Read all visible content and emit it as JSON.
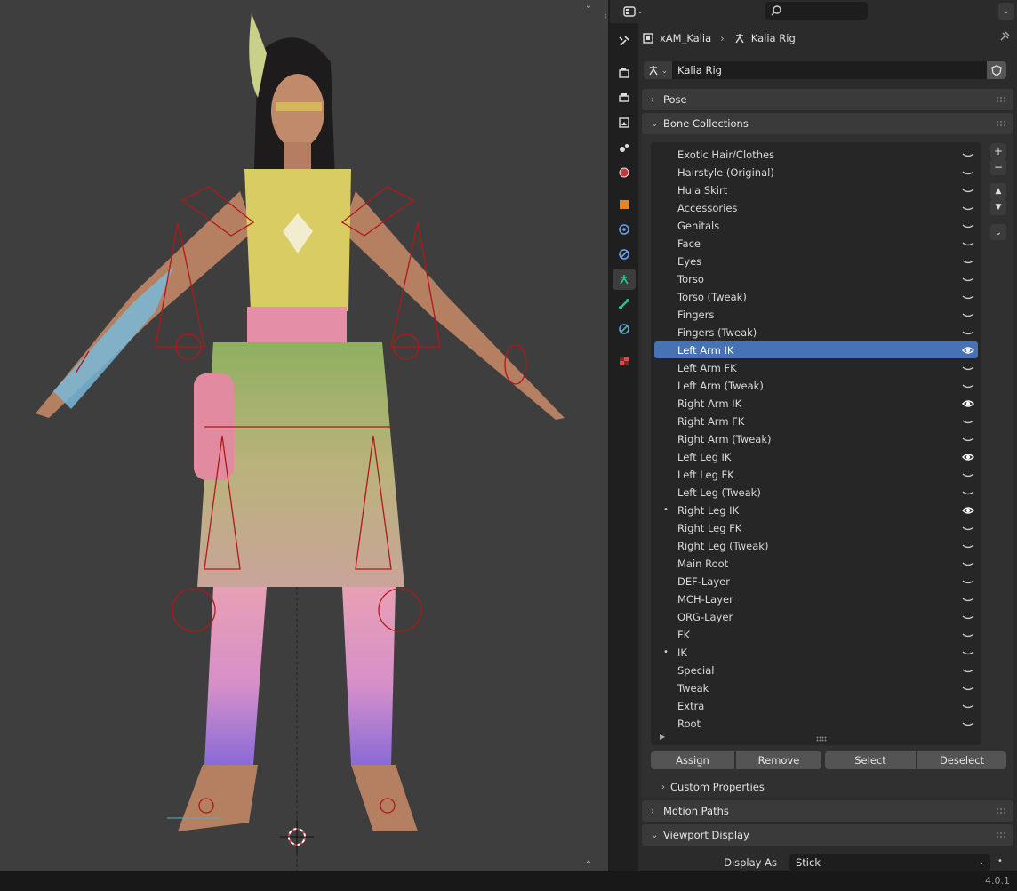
{
  "header": {
    "search_placeholder": ""
  },
  "breadcrumb": {
    "object_name": "xAM_Kalia",
    "armature_name": "Kalia Rig"
  },
  "datablock": {
    "name": "Kalia Rig"
  },
  "panels": {
    "pose": "Pose",
    "bone_collections": "Bone Collections",
    "custom_properties": "Custom Properties",
    "motion_paths": "Motion Paths",
    "viewport_display": "Viewport Display"
  },
  "bone_collections": [
    {
      "name": "Exotic Hair/Clothes",
      "visible": false,
      "dot": false
    },
    {
      "name": "Hairstyle (Original)",
      "visible": false,
      "dot": false
    },
    {
      "name": "Hula Skirt",
      "visible": false,
      "dot": false
    },
    {
      "name": "Accessories",
      "visible": false,
      "dot": false
    },
    {
      "name": "Genitals",
      "visible": false,
      "dot": false
    },
    {
      "name": "Face",
      "visible": false,
      "dot": false
    },
    {
      "name": "Eyes",
      "visible": false,
      "dot": false
    },
    {
      "name": "Torso",
      "visible": false,
      "dot": false
    },
    {
      "name": "Torso (Tweak)",
      "visible": false,
      "dot": false
    },
    {
      "name": "Fingers",
      "visible": false,
      "dot": false
    },
    {
      "name": "Fingers (Tweak)",
      "visible": false,
      "dot": false
    },
    {
      "name": "Left Arm IK",
      "visible": true,
      "dot": false,
      "selected": true
    },
    {
      "name": "Left Arm FK",
      "visible": false,
      "dot": false
    },
    {
      "name": "Left Arm (Tweak)",
      "visible": false,
      "dot": false
    },
    {
      "name": "Right Arm IK",
      "visible": true,
      "dot": false
    },
    {
      "name": "Right Arm FK",
      "visible": false,
      "dot": false
    },
    {
      "name": "Right Arm (Tweak)",
      "visible": false,
      "dot": false
    },
    {
      "name": "Left Leg IK",
      "visible": true,
      "dot": false
    },
    {
      "name": "Left Leg FK",
      "visible": false,
      "dot": false
    },
    {
      "name": "Left Leg (Tweak)",
      "visible": false,
      "dot": false
    },
    {
      "name": "Right Leg IK",
      "visible": true,
      "dot": true
    },
    {
      "name": "Right Leg FK",
      "visible": false,
      "dot": false
    },
    {
      "name": "Right Leg (Tweak)",
      "visible": false,
      "dot": false
    },
    {
      "name": "Main Root",
      "visible": false,
      "dot": false
    },
    {
      "name": "DEF-Layer",
      "visible": false,
      "dot": false
    },
    {
      "name": "MCH-Layer",
      "visible": false,
      "dot": false
    },
    {
      "name": "ORG-Layer",
      "visible": false,
      "dot": false
    },
    {
      "name": "FK",
      "visible": false,
      "dot": false
    },
    {
      "name": "IK",
      "visible": false,
      "dot": true
    },
    {
      "name": "Special",
      "visible": false,
      "dot": false
    },
    {
      "name": "Tweak",
      "visible": false,
      "dot": false
    },
    {
      "name": "Extra",
      "visible": false,
      "dot": false
    },
    {
      "name": "Root",
      "visible": false,
      "dot": false
    }
  ],
  "buttons": {
    "assign": "Assign",
    "remove": "Remove",
    "select": "Select",
    "deselect": "Deselect"
  },
  "viewport_display": {
    "display_as_label": "Display As",
    "display_as_value": "Stick"
  },
  "status": {
    "version": "4.0.1"
  },
  "colors": {
    "selection": "#4772b3",
    "panel_header": "#3a3a3a",
    "panel_bg": "#303030",
    "list_bg": "#262626",
    "viewport_bg": "#3e3e3e",
    "rig_red": "#b01818"
  }
}
